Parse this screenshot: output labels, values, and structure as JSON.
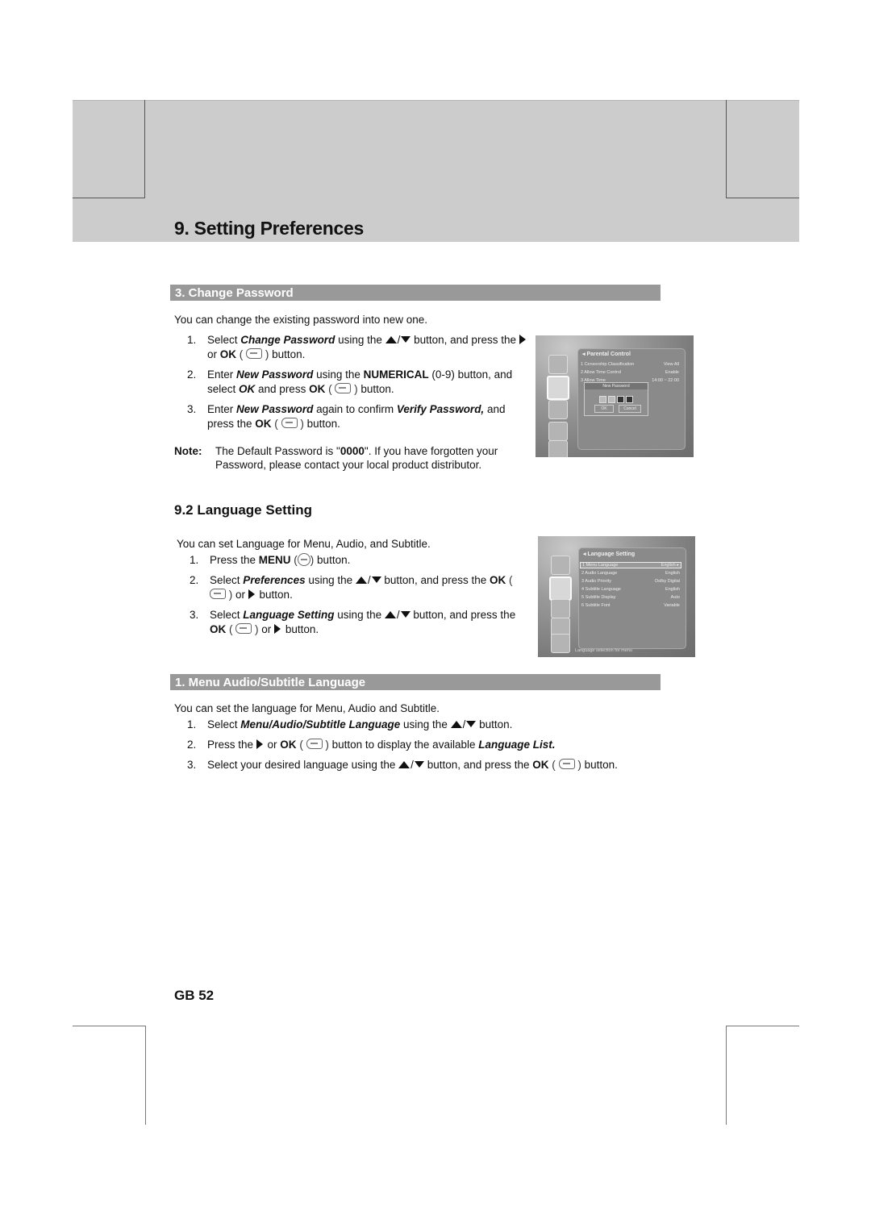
{
  "page": {
    "title": "9. Setting Preferences",
    "page_number": "GB 52"
  },
  "change_password": {
    "heading": "3. Change Password",
    "intro": "You can change the existing password into new one.",
    "steps": [
      {
        "num": "1.",
        "a": "Select ",
        "em1": "Change Password",
        "b": " using the ",
        "c": " button, and press the ",
        "d": " or ",
        "ok": "OK",
        "e": " button."
      },
      {
        "num": "2.",
        "a": "Enter ",
        "em1": "New Password",
        "b": " using the ",
        "strong1": "NUMERICAL",
        "c": " (0-9) button, and select ",
        "em2": "OK",
        "d": " and press ",
        "ok": "OK",
        "e": " button."
      },
      {
        "num": "3.",
        "a": "Enter ",
        "em1": "New Password",
        "b": " again to confirm ",
        "em2": "Verify Password,",
        "c": " and press the ",
        "ok": "OK",
        "e": " button."
      }
    ],
    "note_label": "Note:",
    "note_a": "The Default Password is \"",
    "note_code": "0000",
    "note_b": "\". If you have forgotten your Password, please contact your local product distributor."
  },
  "screen_parental": {
    "title": "Parental Control",
    "rows": [
      {
        "label": "1  Censorship Classification",
        "value": "View All"
      },
      {
        "label": "2  Allow Time Control",
        "value": "Enable"
      },
      {
        "label": "3  Allow Time",
        "value": "14:00 ~ 22:00"
      }
    ],
    "dialog_title": "New Password",
    "dialog_ok": "OK",
    "dialog_cancel": "Cancel"
  },
  "language_setting": {
    "heading": "9.2 Language Setting",
    "intro": "You can set Language for Menu, Audio, and Subtitle.",
    "steps": [
      {
        "num": "1.",
        "a": "Press the ",
        "strong1": "MENU",
        "e": " button."
      },
      {
        "num": "2.",
        "a": "Select ",
        "em1": "Preferences",
        "b": " using the ",
        "c": " button, and press the ",
        "ok": "OK",
        "d": " or ",
        "e": " button."
      },
      {
        "num": "3.",
        "a": "Select ",
        "em1": "Language Setting",
        "b": " using the ",
        "c": " button, and press the ",
        "ok": "OK",
        "d": " or ",
        "e": " button."
      }
    ]
  },
  "screen_language": {
    "title": "Language Setting",
    "rows": [
      {
        "label": "1  Menu Language",
        "value": "English ▸"
      },
      {
        "label": "2  Audio Language",
        "value": "English"
      },
      {
        "label": "3  Audio Priority",
        "value": "Dolby Digital"
      },
      {
        "label": "4  Subtitle Language",
        "value": "English"
      },
      {
        "label": "5  Subtitle Display",
        "value": "Auto"
      },
      {
        "label": "6  Subtitle Font",
        "value": "Variable"
      }
    ],
    "footer": "Language selection for menu"
  },
  "menu_audio_subtitle": {
    "heading": "1. Menu Audio/Subtitle Language",
    "intro": "You can set the language for Menu, Audio and Subtitle.",
    "steps": [
      {
        "num": "1.",
        "a": "Select ",
        "em1": "Menu/Audio/Subtitle Language",
        "b": " using the ",
        "e": " button."
      },
      {
        "num": "2.",
        "a": "Press the ",
        "d": " or ",
        "ok": "OK",
        "c": " button to display the available ",
        "em2": "Language List."
      },
      {
        "num": "3.",
        "a": "Select your desired language using the ",
        "c": " button, and press the ",
        "ok": "OK",
        "e": " button."
      }
    ]
  },
  "icons": {
    "up_down": "up-down-arrow-buttons",
    "right": "right-arrow-button",
    "ok": "ok-button",
    "menu": "menu-button"
  }
}
